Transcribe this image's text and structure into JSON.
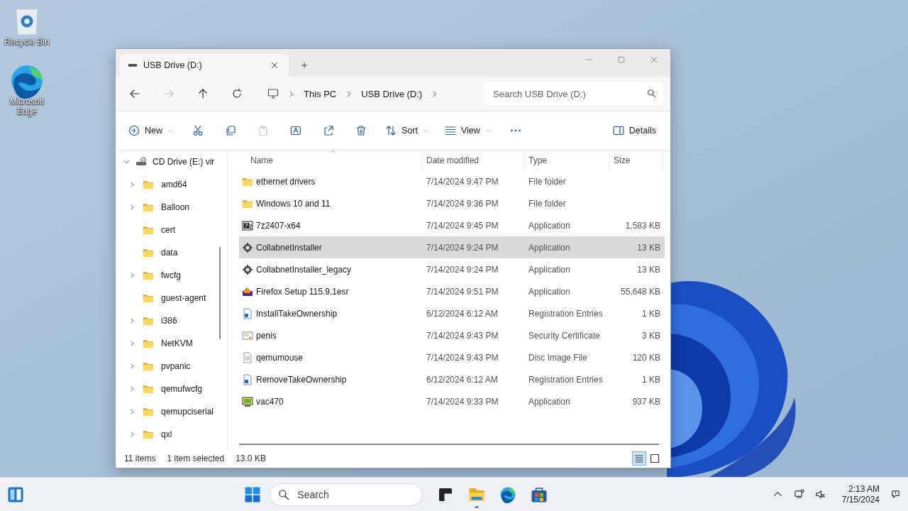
{
  "desktop_icons": [
    {
      "kind": "recycle",
      "label": "Recycle Bin"
    },
    {
      "kind": "edge",
      "label": "Microsoft Edge"
    }
  ],
  "window": {
    "tabs": [
      {
        "title": "USB Drive (D:)",
        "selected": true
      }
    ],
    "nav_buttons": [
      {
        "kind": "back",
        "disabled": false
      },
      {
        "kind": "forward",
        "disabled": true
      },
      {
        "kind": "up",
        "disabled": false
      },
      {
        "kind": "refresh",
        "disabled": false
      }
    ],
    "breadcrumbs": [
      "This PC",
      "USB Drive (D:)"
    ],
    "search": {
      "placeholder": "Search USB Drive (D:)"
    },
    "toolbar": [
      {
        "kind": "new",
        "label": "New",
        "dropdown": true,
        "disabled": false
      },
      {
        "kind": "cut",
        "disabled": false
      },
      {
        "kind": "copy",
        "disabled": false
      },
      {
        "kind": "paste",
        "disabled": true
      },
      {
        "kind": "rename",
        "disabled": false
      },
      {
        "kind": "share",
        "disabled": false
      },
      {
        "kind": "delete",
        "disabled": false
      },
      {
        "kind": "sort",
        "label": "Sort",
        "dropdown": true,
        "disabled": false
      },
      {
        "kind": "view",
        "label": "View",
        "dropdown": true,
        "disabled": false
      },
      {
        "kind": "more",
        "disabled": false
      }
    ],
    "details_button": {
      "label": "Details"
    },
    "nav_tree": [
      {
        "label": "CD Drive (E:) vir",
        "kind": "cd",
        "expanded": true,
        "children": [
          {
            "label": "amd64",
            "has_children": true
          },
          {
            "label": "Balloon",
            "has_children": true
          },
          {
            "label": "cert",
            "has_children": false
          },
          {
            "label": "data",
            "has_children": false
          },
          {
            "label": "fwcfg",
            "has_children": true
          },
          {
            "label": "guest-agent",
            "has_children": false
          },
          {
            "label": "i386",
            "has_children": true
          },
          {
            "label": "NetKVM",
            "has_children": true
          },
          {
            "label": "pvpanic",
            "has_children": true
          },
          {
            "label": "qemufwcfg",
            "has_children": true
          },
          {
            "label": "qemupciserial",
            "has_children": true
          },
          {
            "label": "qxl",
            "has_children": true
          }
        ]
      }
    ],
    "files": {
      "columns": [
        {
          "label": "Name",
          "sorted": true
        },
        {
          "label": "Date modified",
          "sorted": false
        },
        {
          "label": "Type",
          "sorted": false
        },
        {
          "label": "Size",
          "sorted": false
        }
      ],
      "rows": [
        {
          "kind": "folder",
          "name": "ethernet drivers",
          "date": "7/14/2024 9:47 PM",
          "type": "File folder",
          "size": "",
          "selected": false
        },
        {
          "kind": "folder",
          "name": "Windows 10 and 11",
          "date": "7/14/2024 9:36 PM",
          "type": "File folder",
          "selected": false
        },
        {
          "kind": "archive",
          "name": "7z2407-x64",
          "date": "7/14/2024 9:45 PM",
          "type": "Application",
          "size": "1,583 KB",
          "selected": false
        },
        {
          "kind": "installer",
          "name": "CollabnetInstaller",
          "date": "7/14/2024 9:24 PM",
          "type": "Application",
          "size": "13 KB",
          "selected": true
        },
        {
          "kind": "installer",
          "name": "CollabnetInstaller_legacy",
          "date": "7/14/2024 9:24 PM",
          "type": "Application",
          "size": "13 KB",
          "selected": false
        },
        {
          "kind": "flame",
          "name": "Firefox Setup 115.9.1esr",
          "date": "7/14/2024 9:51 PM",
          "type": "Application",
          "size": "55,648 KB",
          "selected": false
        },
        {
          "kind": "registry",
          "name": "InstallTakeOwnership",
          "date": "6/12/2024 6:12 AM",
          "type": "Registration Entries",
          "size": "1 KB",
          "selected": false
        },
        {
          "kind": "certificate",
          "name": "penis",
          "date": "7/14/2024 9:43 PM",
          "type": "Security Certificate",
          "size": "3 KB",
          "selected": false
        },
        {
          "kind": "disc",
          "name": "qemumouse",
          "date": "7/14/2024 9:43 PM",
          "type": "Disc Image File",
          "size": "120 KB",
          "selected": false
        },
        {
          "kind": "registry",
          "name": "RemoveTakeOwnership",
          "date": "6/12/2024 6:12 AM",
          "type": "Registration Entries",
          "size": "1 KB",
          "selected": false
        },
        {
          "kind": "monitor",
          "name": "vac470",
          "date": "7/14/2024 9:33 PM",
          "type": "Application",
          "size": "937 KB",
          "selected": false
        }
      ]
    },
    "status_bar": {
      "item_count": "11 items",
      "selection": "1 item selected",
      "selection_size": "13.0 KB",
      "views": [
        {
          "kind": "details",
          "selected": true
        },
        {
          "kind": "tiles",
          "selected": false
        }
      ]
    }
  },
  "taskbar": {
    "search": {
      "placeholder": "Search"
    },
    "apps": [
      {
        "kind": "taskview",
        "running": false
      },
      {
        "kind": "explorer",
        "running": true
      },
      {
        "kind": "edge",
        "running": false
      },
      {
        "kind": "store",
        "running": false
      }
    ],
    "time": "2:13 AM",
    "date": "7/15/2024"
  }
}
